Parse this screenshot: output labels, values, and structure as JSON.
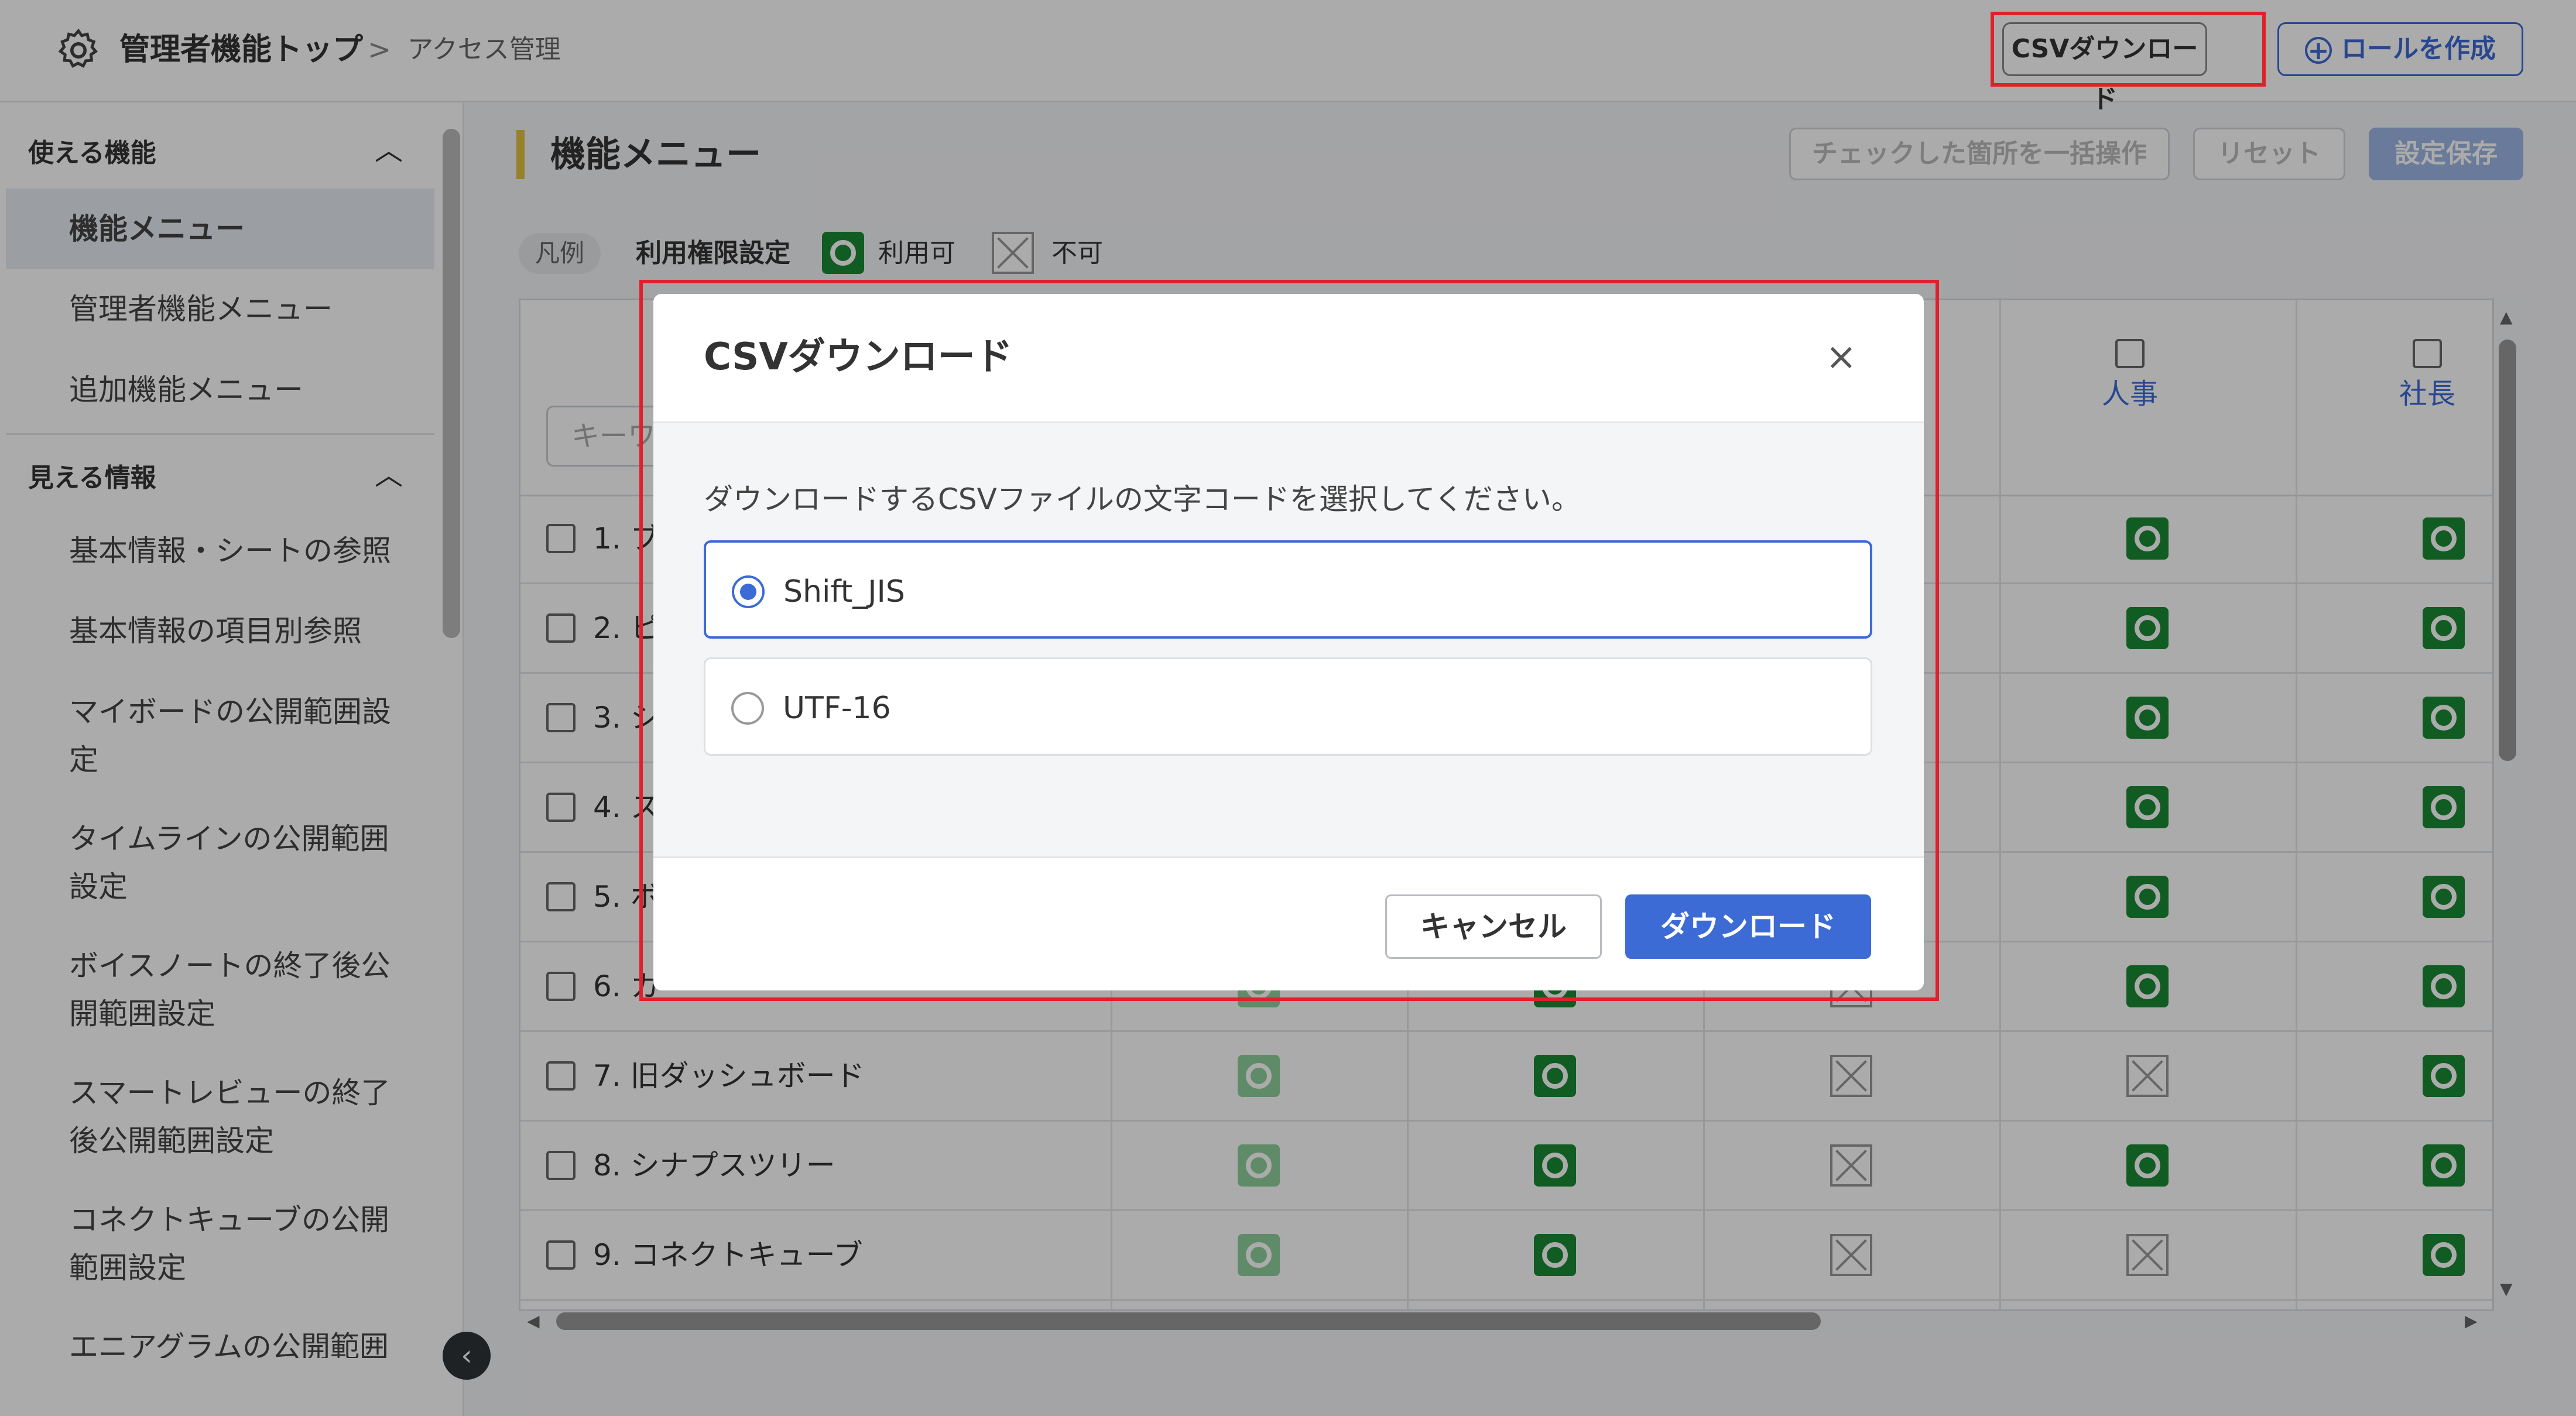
{
  "header": {
    "title": "管理者機能トップ",
    "separator": ">",
    "breadcrumb": "アクセス管理",
    "csv_button": "CSVダウンロード",
    "role_button": "ロールを作成"
  },
  "sidebar": {
    "section1": "使える機能",
    "section1_items": [
      "機能メニュー",
      "管理者機能メニュー",
      "追加機能メニュー"
    ],
    "section2": "見える情報",
    "section2_items": [
      "基本情報・シートの参照",
      "基本情報の項目別参照",
      "マイボードの公開範囲設定",
      "タイムラインの公開範囲設定",
      "ボイスノートの終了後公開範囲設定",
      "スマートレビューの終了後公開範囲設定",
      "コネクトキューブの公開範囲設定",
      "エニアグラムの公開範囲"
    ]
  },
  "main": {
    "title": "機能メニュー",
    "bulk_button": "チェックした箇所を一括操作",
    "reset_button": "リセット",
    "save_button": "設定保存",
    "legend_tag": "凡例",
    "legend_label": "利用権限設定",
    "legend_ok": "利用可",
    "legend_ng": "不可",
    "keyword_placeholder": "キーワ",
    "columns": [
      "人事",
      "社長"
    ],
    "rows": [
      {
        "label": "1. ブ",
        "cells": [
          "",
          "",
          "",
          "ok",
          "ok"
        ]
      },
      {
        "label": "2. ピ",
        "cells": [
          "",
          "",
          "",
          "ok",
          "ok"
        ]
      },
      {
        "label": "3. シ",
        "cells": [
          "",
          "",
          "",
          "ok",
          "ok"
        ]
      },
      {
        "label": "4. ス",
        "cells": [
          "",
          "",
          "",
          "ok",
          "ok"
        ]
      },
      {
        "label": "5. ボ",
        "cells": [
          "",
          "",
          "",
          "ok",
          "ok"
        ]
      },
      {
        "label": "6. カ",
        "cells": [
          "okl",
          "ok",
          "ng",
          "ok",
          "ok"
        ]
      },
      {
        "label": "7. 旧ダッシュボード",
        "cells": [
          "okl",
          "ok",
          "ng",
          "ng",
          "ok"
        ]
      },
      {
        "label": "8. シナプスツリー",
        "cells": [
          "okl",
          "ok",
          "ng",
          "ok",
          "ok"
        ]
      },
      {
        "label": "9. コネクトキューブ",
        "cells": [
          "okl",
          "ok",
          "ng",
          "ng",
          "ok"
        ]
      }
    ]
  },
  "modal": {
    "title": "CSVダウンロード",
    "close": "×",
    "description": "ダウンロードするCSVファイルの文字コードを選択してください。",
    "options": [
      "Shift_JIS",
      "UTF-16"
    ],
    "selected": "Shift_JIS",
    "cancel": "キャンセル",
    "download": "ダウンロード"
  },
  "colors": {
    "accent": "#3d6bd6",
    "ok": "#1a8a35",
    "highlight": "#e0202b"
  }
}
